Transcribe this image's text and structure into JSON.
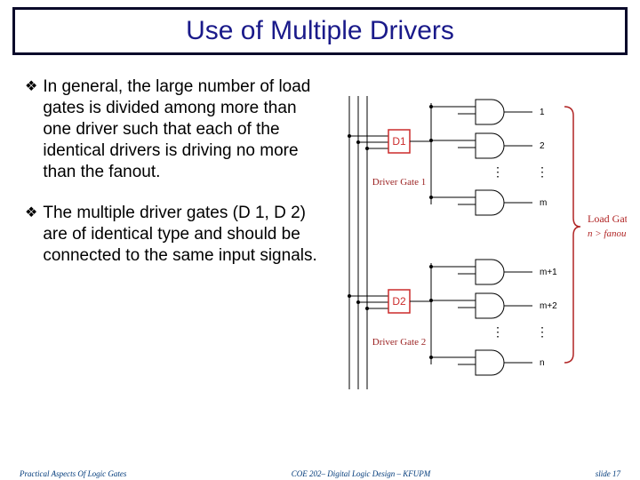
{
  "title": "Use of Multiple Drivers",
  "bullets": [
    "In general, the large number of load gates is divided among more than one driver such that each of the identical drivers is driving no more than the fanout.",
    "The multiple driver gates (D 1, D 2) are of identical type and should be connected to the same input signals."
  ],
  "diagram": {
    "drivers": [
      {
        "name": "D1",
        "label": "Driver Gate 1",
        "load_labels": [
          "1",
          "2",
          "m"
        ]
      },
      {
        "name": "D2",
        "label": "Driver Gate 2",
        "load_labels": [
          "m+1",
          "m+2",
          "n"
        ]
      }
    ],
    "right_caption_top": "Load Gates",
    "right_caption_bottom": "n > fanout",
    "colors": {
      "driver_box": "#cc2b2b",
      "driver_label": "#9a1f1f",
      "caption": "#b02424"
    }
  },
  "footer": {
    "left": "Practical Aspects Of Logic Gates",
    "center": "COE 202– Digital Logic Design – KFUPM",
    "right": "slide 17"
  }
}
